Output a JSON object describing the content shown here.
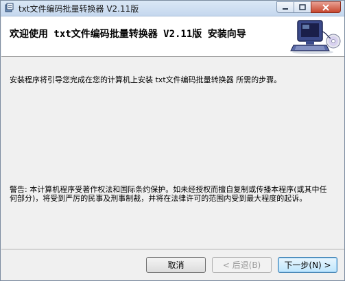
{
  "window": {
    "title": "txt文件编码批量转换器 V2.11版",
    "icon": "installer-icon"
  },
  "banner": {
    "heading": "欢迎使用 txt文件编码批量转换器 V2.11版 安装向导",
    "art": "computer-cd-icon"
  },
  "content": {
    "intro": "安装程序将引导您完成在您的计算机上安装  txt文件编码批量转换器 所需的步骤。",
    "warning": "警告: 本计算机程序受著作权法和国际条约保护。如未经授权而擅自复制或传播本程序(或其中任何部分)，将受到严厉的民事及刑事制裁，并将在法律许可的范围内受到最大程度的起诉。"
  },
  "buttons": {
    "cancel": "取消",
    "back": "< 后退(B)",
    "next": "下一步(N) >"
  },
  "colors": {
    "titlebar": "#c4d7ee",
    "close_button": "#c8472f",
    "default_button_border": "#3c7fb1"
  }
}
